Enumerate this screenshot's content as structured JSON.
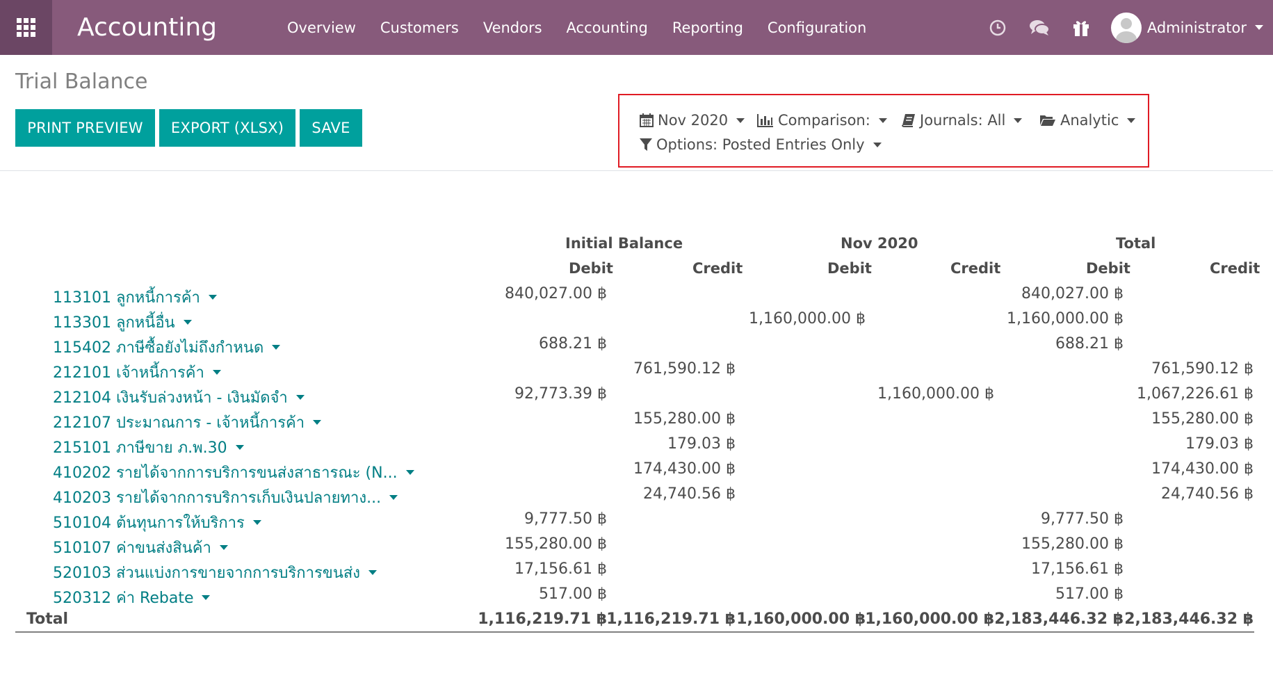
{
  "navbar": {
    "app_title": "Accounting",
    "menu": [
      "Overview",
      "Customers",
      "Vendors",
      "Accounting",
      "Reporting",
      "Configuration"
    ],
    "user_name": "Administrator"
  },
  "page": {
    "title": "Trial Balance",
    "buttons": {
      "print_preview": "PRINT PREVIEW",
      "export": "EXPORT (XLSX)",
      "save": "SAVE"
    }
  },
  "filters": {
    "date": "Nov 2020",
    "comparison": "Comparison:",
    "journals": "Journals: All",
    "analytic": "Analytic",
    "options": "Options: Posted Entries Only"
  },
  "table": {
    "groups": [
      "Initial Balance",
      "Nov 2020",
      "Total"
    ],
    "subheaders": [
      "Debit",
      "Credit",
      "Debit",
      "Credit",
      "Debit",
      "Credit"
    ],
    "rows": [
      {
        "account": "113101 ลูกหนี้การค้า",
        "values": [
          "840,027.00 ฿",
          "",
          "",
          "",
          "840,027.00 ฿",
          ""
        ]
      },
      {
        "account": "113301 ลูกหนี้อื่น",
        "values": [
          "",
          "",
          "1,160,000.00 ฿",
          "",
          "1,160,000.00 ฿",
          ""
        ]
      },
      {
        "account": "115402 ภาษีซื้อยังไม่ถึงกำหนด",
        "values": [
          "688.21 ฿",
          "",
          "",
          "",
          "688.21 ฿",
          ""
        ]
      },
      {
        "account": "212101 เจ้าหนี้การค้า",
        "values": [
          "",
          "761,590.12 ฿",
          "",
          "",
          "",
          "761,590.12 ฿"
        ]
      },
      {
        "account": "212104 เงินรับล่วงหน้า - เงินมัดจำ",
        "values": [
          "92,773.39 ฿",
          "",
          "",
          "1,160,000.00 ฿",
          "",
          "1,067,226.61 ฿"
        ]
      },
      {
        "account": "212107 ประมาณการ - เจ้าหนี้การค้า",
        "values": [
          "",
          "155,280.00 ฿",
          "",
          "",
          "",
          "155,280.00 ฿"
        ]
      },
      {
        "account": "215101 ภาษีขาย ภ.พ.30",
        "values": [
          "",
          "179.03 ฿",
          "",
          "",
          "",
          "179.03 ฿"
        ]
      },
      {
        "account": "410202 รายได้จากการบริการขนส่งสาธารณะ (N...",
        "values": [
          "",
          "174,430.00 ฿",
          "",
          "",
          "",
          "174,430.00 ฿"
        ]
      },
      {
        "account": "410203 รายได้จากการบริการเก็บเงินปลายทาง...",
        "values": [
          "",
          "24,740.56 ฿",
          "",
          "",
          "",
          "24,740.56 ฿"
        ]
      },
      {
        "account": "510104 ต้นทุนการให้บริการ",
        "values": [
          "9,777.50 ฿",
          "",
          "",
          "",
          "9,777.50 ฿",
          ""
        ]
      },
      {
        "account": "510107 ค่าขนส่งสินค้า",
        "values": [
          "155,280.00 ฿",
          "",
          "",
          "",
          "155,280.00 ฿",
          ""
        ]
      },
      {
        "account": "520103 ส่วนแบ่งการขายจากการบริการขนส่ง",
        "values": [
          "17,156.61 ฿",
          "",
          "",
          "",
          "17,156.61 ฿",
          ""
        ]
      },
      {
        "account": "520312 ค่า Rebate",
        "values": [
          "517.00 ฿",
          "",
          "",
          "",
          "517.00 ฿",
          ""
        ]
      }
    ],
    "total": {
      "label": "Total",
      "values": [
        "1,116,219.71 ฿",
        "1,116,219.71 ฿",
        "1,160,000.00 ฿",
        "1,160,000.00 ฿",
        "2,183,446.32 ฿",
        "2,183,446.32 ฿"
      ]
    }
  }
}
